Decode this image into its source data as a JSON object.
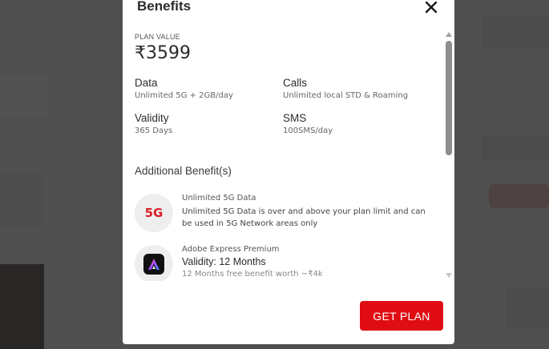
{
  "modal": {
    "title": "Benefits",
    "close_icon": "close-icon",
    "plan_value_label": "PLAN VALUE",
    "plan_value": "₹3599",
    "details": {
      "data": {
        "title": "Data",
        "value": "Unlimited 5G + 2GB/day"
      },
      "calls": {
        "title": "Calls",
        "value": "Unlimited local STD & Roaming"
      },
      "validity": {
        "title": "Validity",
        "value": "365 Days"
      },
      "sms": {
        "title": "SMS",
        "value": "100SMS/day"
      }
    },
    "additional_title": "Additional Benefit(s)",
    "benefits": [
      {
        "icon": "5g-icon",
        "icon_text": "5G",
        "name": "Unlimited 5G Data",
        "description": "Unlimited 5G Data is over and above your plan limit and can be used in 5G Network areas only"
      },
      {
        "icon": "adobe-express-icon",
        "name": "Adobe Express Premium",
        "validity": "Validity: 12 Months",
        "worth": "12 Months free benefit worth ~₹4k"
      }
    ],
    "cta_label": "GET PLAN"
  },
  "colors": {
    "accent_red": "#e00c14",
    "fiveg_red": "#d81f26",
    "text_dark": "#2b2b2b",
    "overlay": "#5e5e5e"
  }
}
